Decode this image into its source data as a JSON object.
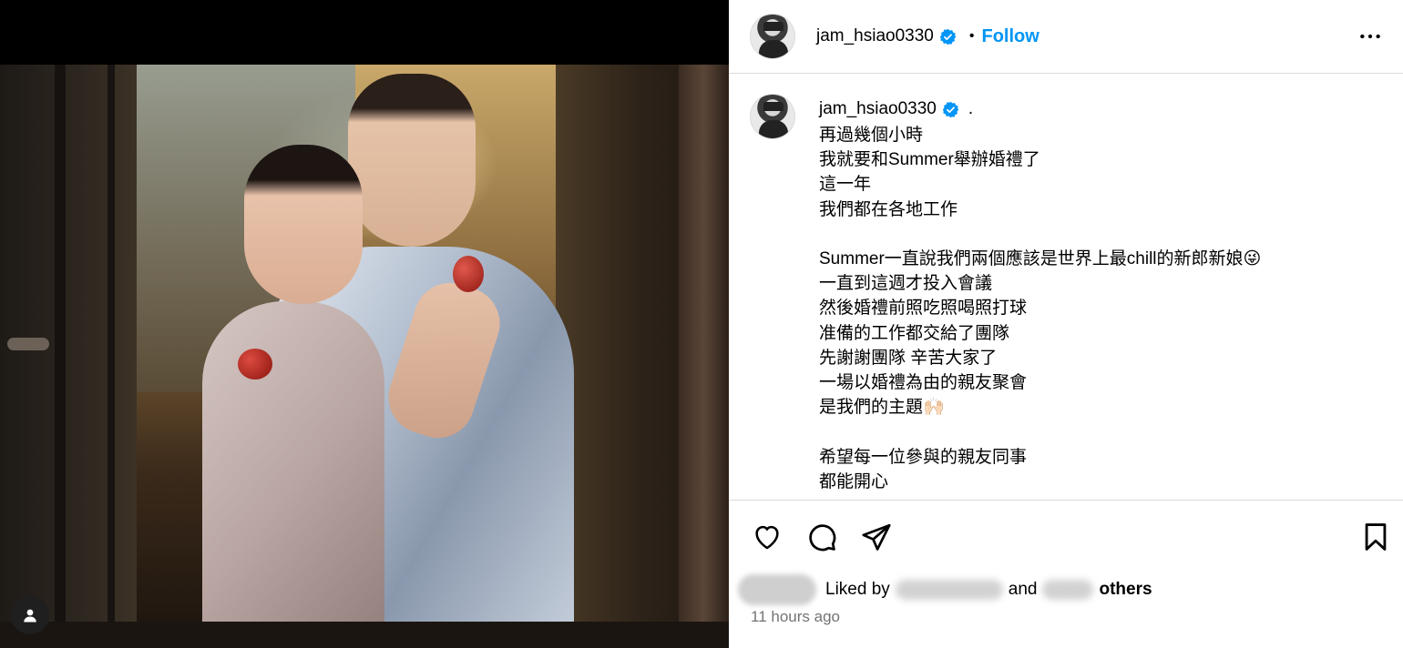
{
  "post": {
    "username": "jam_hsiao0330",
    "dot": "•",
    "follow_label": "Follow",
    "caption_trailing": ".",
    "caption_text": "再過幾個小時\n我就要和Summer舉辦婚禮了\n這一年\n我們都在各地工作\n\nSummer一直說我們兩個應該是世界上最chill的新郎新娘😜\n一直到這週才投入會議\n然後婚禮前照吃照喝照打球\n准備的工作都交給了團隊\n先謝謝團隊 辛苦大家了\n一場以婚禮為由的親友聚會\n是我們的主題🙌🏻\n\n希望每一位參與的親友同事\n都能開心",
    "liked_by_prefix": "Liked by",
    "liked_and": "and",
    "liked_others": "others",
    "timestamp": "11 hours ago"
  },
  "icons": {
    "verified": "verified-badge-icon",
    "more": "more-options-icon",
    "like": "heart-icon",
    "comment": "comment-icon",
    "share": "share-icon",
    "save": "bookmark-icon",
    "tags": "user-tag-icon"
  },
  "colors": {
    "accent": "#0095f6",
    "verified": "#0095f6",
    "secondary_text": "#737373",
    "divider": "#dbdbdb"
  }
}
